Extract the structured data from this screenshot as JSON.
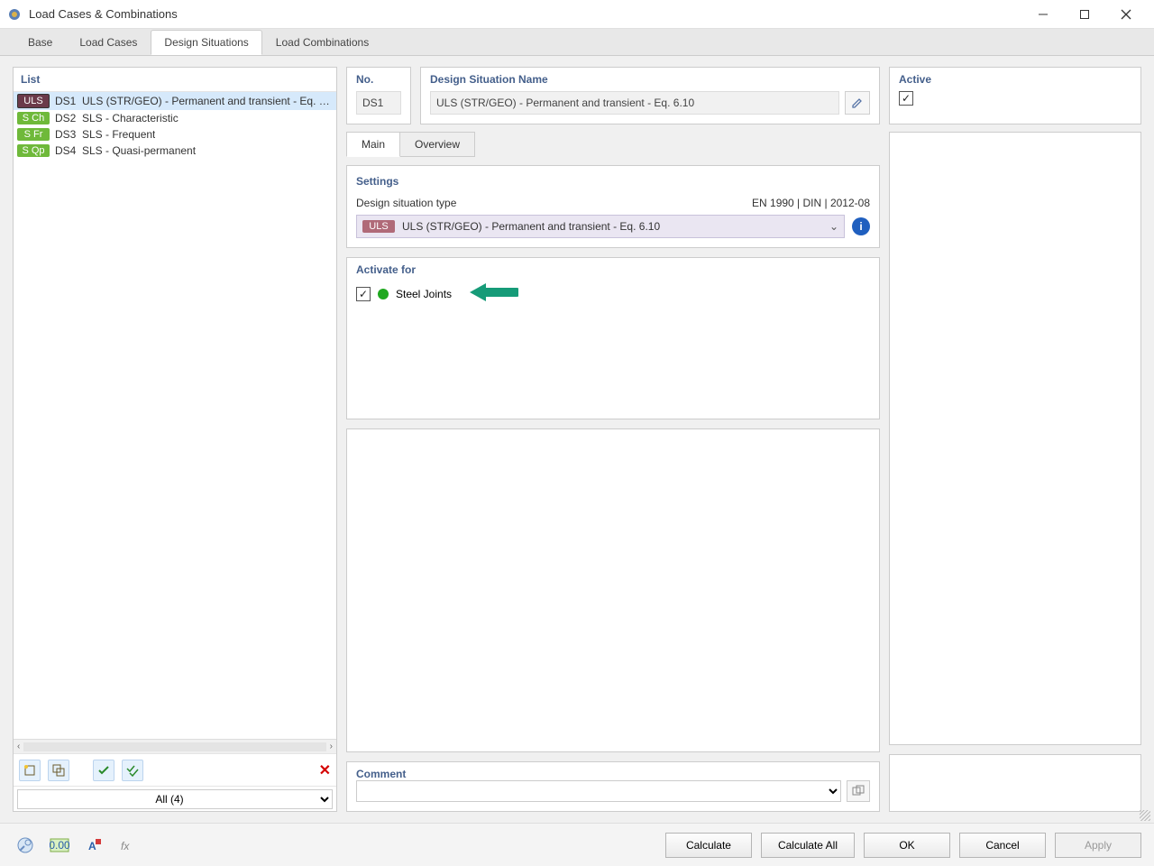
{
  "window": {
    "title": "Load Cases & Combinations"
  },
  "tabs": {
    "base": "Base",
    "load_cases": "Load Cases",
    "design_situations": "Design Situations",
    "load_combinations": "Load Combinations"
  },
  "left": {
    "heading": "List",
    "items": [
      {
        "tag": "ULS",
        "id": "DS1",
        "name": "ULS (STR/GEO) - Permanent and transient - Eq. …"
      },
      {
        "tag": "S Ch",
        "id": "DS2",
        "name": "SLS - Characteristic"
      },
      {
        "tag": "S Fr",
        "id": "DS3",
        "name": "SLS - Frequent"
      },
      {
        "tag": "S Qp",
        "id": "DS4",
        "name": "SLS - Quasi-permanent"
      }
    ],
    "filter": "All (4)"
  },
  "header": {
    "no_label": "No.",
    "no_value": "DS1",
    "name_label": "Design Situation Name",
    "name_value": "ULS (STR/GEO) - Permanent and transient - Eq. 6.10",
    "active_label": "Active"
  },
  "inner_tabs": {
    "main": "Main",
    "overview": "Overview"
  },
  "settings": {
    "title": "Settings",
    "type_label": "Design situation type",
    "standard": "EN 1990 | DIN | 2012-08",
    "dd_tag": "ULS",
    "dd_text": "ULS (STR/GEO) - Permanent and transient - Eq. 6.10"
  },
  "activate": {
    "title": "Activate for",
    "item": "Steel Joints"
  },
  "comment": {
    "title": "Comment"
  },
  "footer": {
    "calculate": "Calculate",
    "calculate_all": "Calculate All",
    "ok": "OK",
    "cancel": "Cancel",
    "apply": "Apply"
  }
}
